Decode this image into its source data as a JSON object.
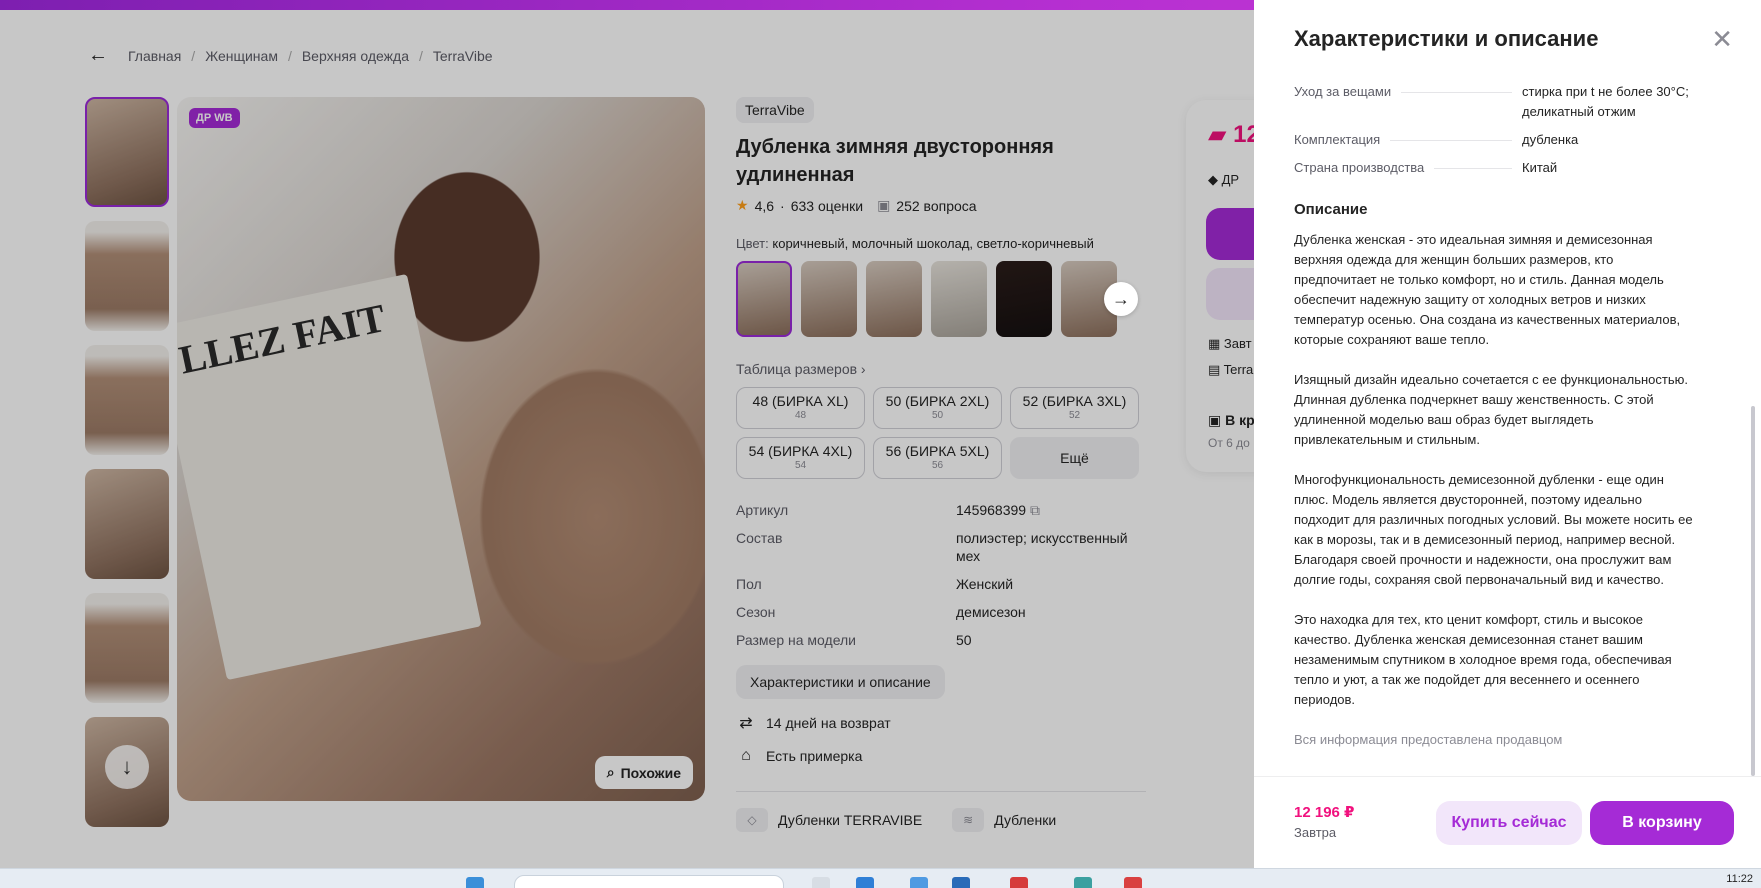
{
  "breadcrumbs": [
    "Главная",
    "Женщинам",
    "Верхняя одежда",
    "TerraVibe"
  ],
  "gallery": {
    "badge": "ДР WB",
    "newspaper_headline": "LLEZ FAIT",
    "similar_label": "Похожие"
  },
  "product": {
    "brand": "TerraVibe",
    "title": "Дубленка зимняя двусторонняя удлиненная",
    "rating": "4,6",
    "ratings_count": "633 оценки",
    "questions": "252 вопроса",
    "color_label": "Цвет:",
    "color_value": "коричневый, молочный шоколад, светло-коричневый",
    "size_table_label": "Таблица размеров ›",
    "sizes": [
      {
        "label": "48 (БИРКА XL)",
        "ru": "48"
      },
      {
        "label": "50 (БИРКА 2XL)",
        "ru": "50"
      },
      {
        "label": "52 (БИРКА 3XL)",
        "ru": "52"
      },
      {
        "label": "54 (БИРКА 4XL)",
        "ru": "54"
      },
      {
        "label": "56 (БИРКА 5XL)",
        "ru": "56"
      }
    ],
    "more_sizes": "Ещё",
    "specs": [
      {
        "k": "Артикул",
        "v": "145968399"
      },
      {
        "k": "Состав",
        "v": "полиэстер; искусственный мех"
      },
      {
        "k": "Пол",
        "v": "Женский"
      },
      {
        "k": "Сезон",
        "v": "демисезон"
      },
      {
        "k": "Размер на модели",
        "v": "50"
      }
    ],
    "characteristics_button": "Характеристики и описание",
    "perks": [
      "14 дней на возврат",
      "Есть примерка"
    ],
    "tags": [
      "Дубленки TERRAVIBE",
      "Дубленки"
    ]
  },
  "buybox": {
    "price": "12",
    "dr": "ДР",
    "line1": "Завт",
    "line2": "Terra",
    "line3": "В кр",
    "line4": "От 6 до"
  },
  "panel": {
    "title": "Характеристики и описание",
    "rows": [
      {
        "k": "Уход за вещами",
        "v": "стирка при t не более 30°C; деликатный отжим"
      },
      {
        "k": "Комплектация",
        "v": "дубленка"
      },
      {
        "k": "Страна производства",
        "v": "Китай"
      }
    ],
    "description_title": "Описание",
    "paragraphs": [
      "Дубленка женская - это идеальная зимняя и демисезонная\nверхняя одежда для женщин больших размеров, кто\nпредпочитает не только комфорт, но и стиль. Данная модель\nобеспечит надежную защиту от холодных ветров и низких\nтемператур осенью. Она создана из качественных материалов,\nкоторые сохраняют ваше тепло.",
      "Изящный дизайн идеально сочетается с ее функциональностью.\nДлинная дубленка подчеркнет вашу женственность. С этой\nудлиненной моделью ваш образ будет выглядеть\nпривлекательным и стильным.",
      "Многофункциональность демисезонной дубленки - еще один\nплюс. Модель является двусторонней, поэтому идеально\nподходит для различных погодных условий. Вы можете носить ее\nкак в морозы, так и в демисезонный период, например весной.\nБлагодаря своей прочности и надежности, она прослужит вам\nдолгие годы, сохраняя свой первоначальный вид и качество.",
      "Это находка для тех, кто ценит комфорт, стиль и высокое\nкачество. Дубленка женская демисезонная станет вашим\nнезаменимым спутником в холодное время года, обеспечивая\nтепло и уют, а так же подойдет для весеннего и осеннего\nпериодов."
    ],
    "seller_note": "Вся информация предоставлена продавцом",
    "footer_price": "12 196 ₽",
    "footer_when": "Завтра",
    "buy_now": "Купить сейчас",
    "to_cart": "В корзину"
  },
  "taskbar": {
    "time": "11:22"
  },
  "colors": {
    "accent": "#a52bd6",
    "price": "#f1117e"
  }
}
